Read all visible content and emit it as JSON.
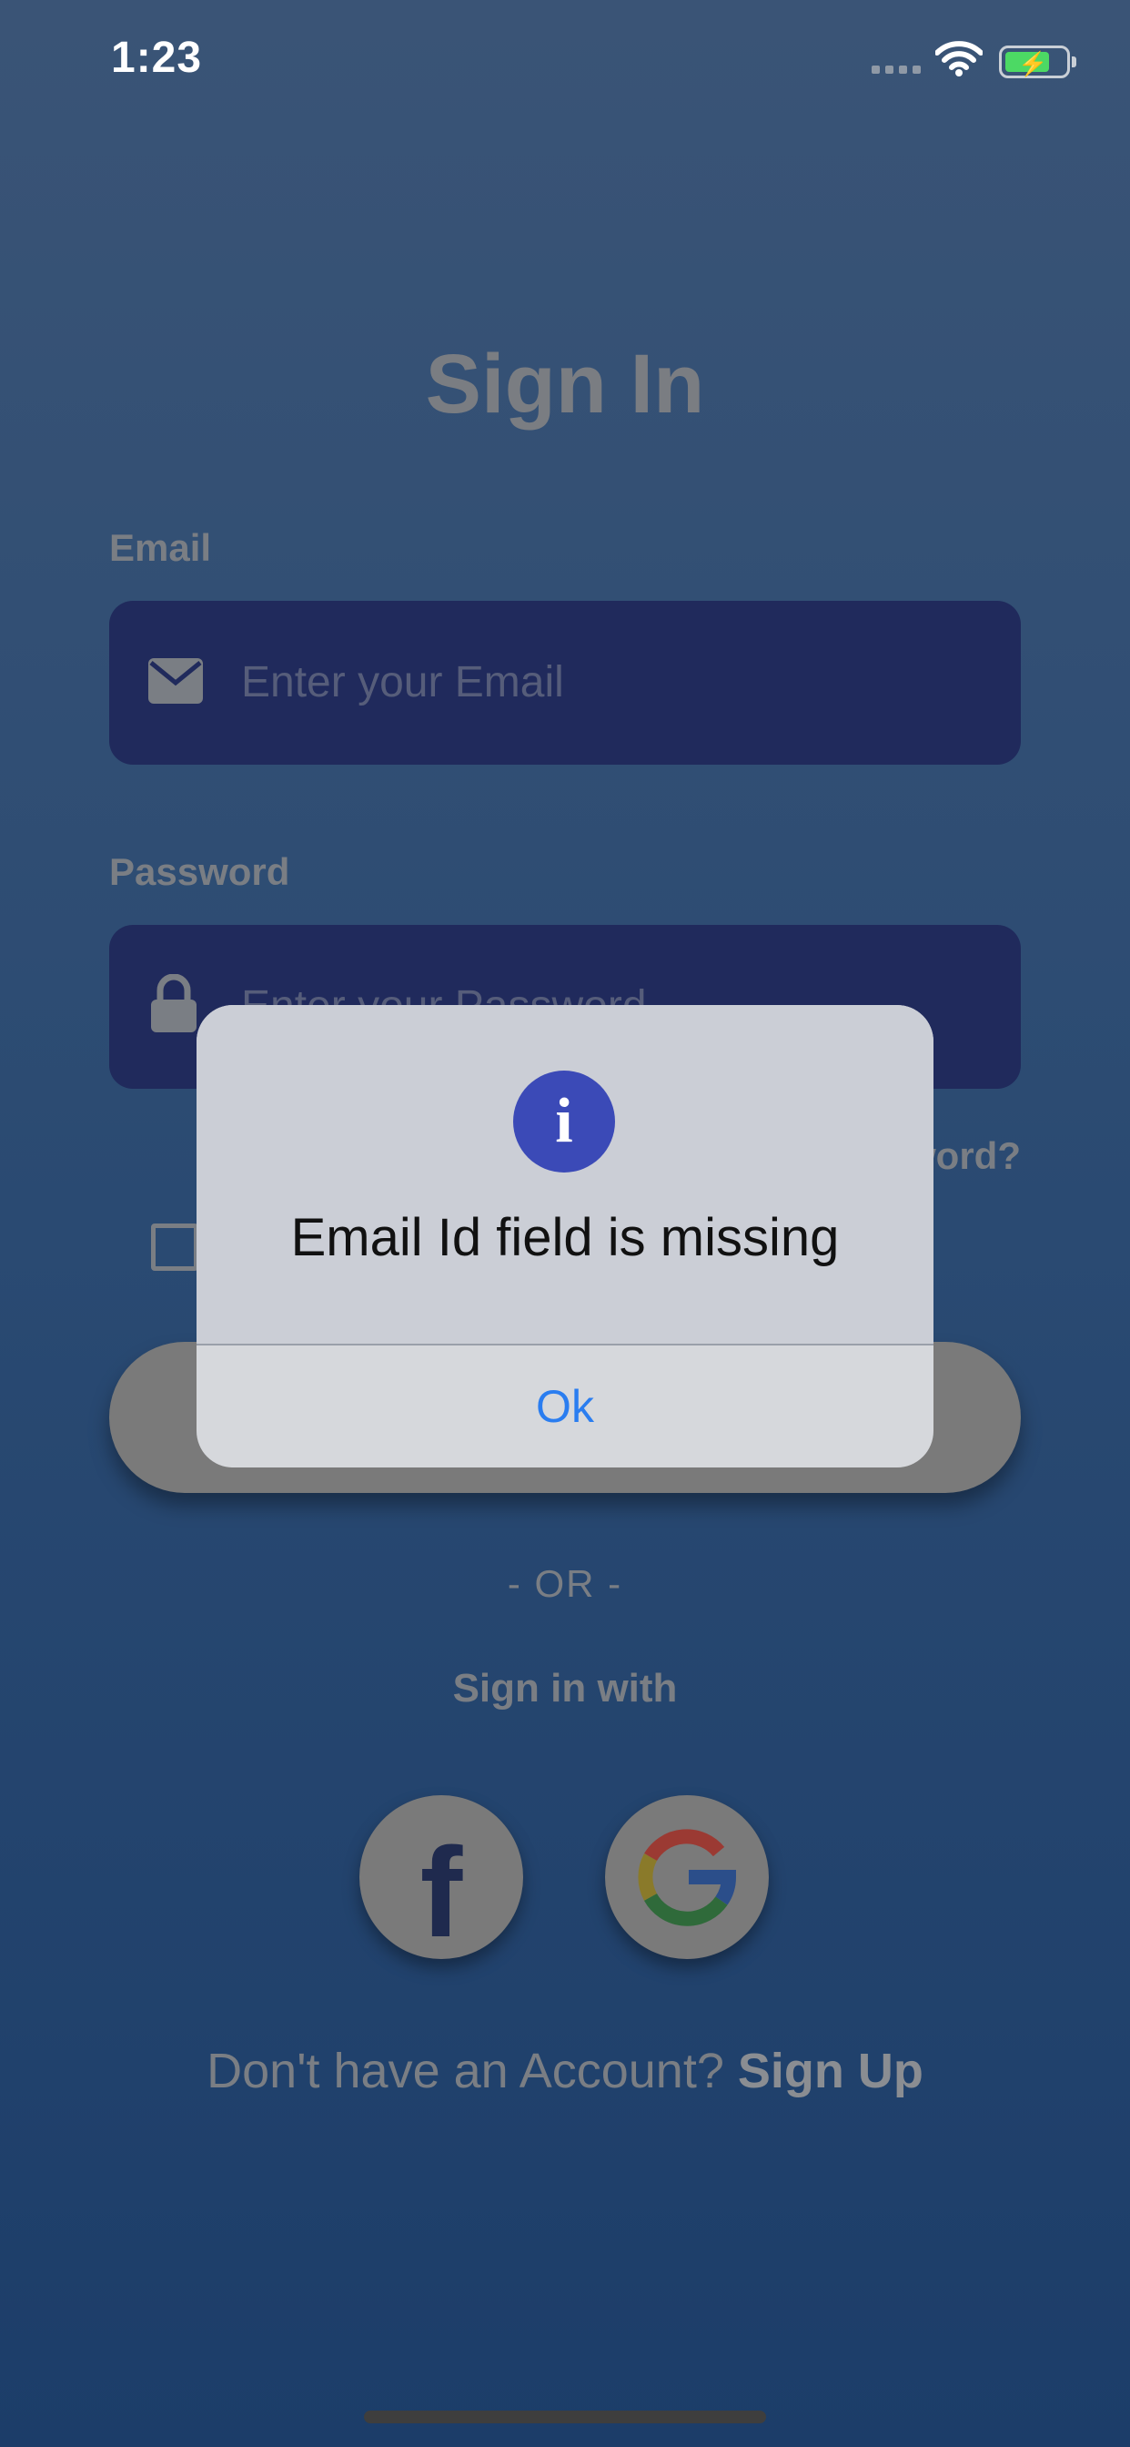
{
  "status_bar": {
    "time": "1:23"
  },
  "screen": {
    "title": "Sign In",
    "email": {
      "label": "Email",
      "placeholder": "Enter your Email"
    },
    "password": {
      "label": "Password",
      "placeholder": "Enter your Password"
    },
    "forgot_password": "Forgot Password?",
    "forgot_password_visible": "word?",
    "or_text": "- OR -",
    "sign_in_with": "Sign in with",
    "signup_prompt": "Don't have an Account?",
    "signup_link": "Sign Up"
  },
  "alert": {
    "message": "Email Id field is missing",
    "ok_label": "Ok",
    "icon": "info-icon"
  },
  "colors": {
    "alert_icon": "#3b4ab7",
    "ok_text": "#2a7df0",
    "field_bg": "#202a5c"
  }
}
